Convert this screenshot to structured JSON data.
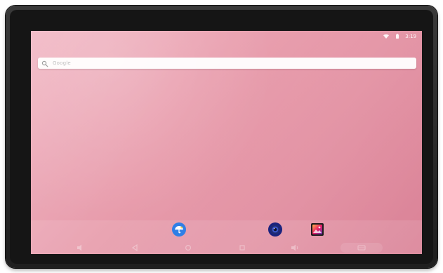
{
  "search": {
    "placeholder": "Google"
  },
  "statusbar": {
    "time": "3:19"
  }
}
